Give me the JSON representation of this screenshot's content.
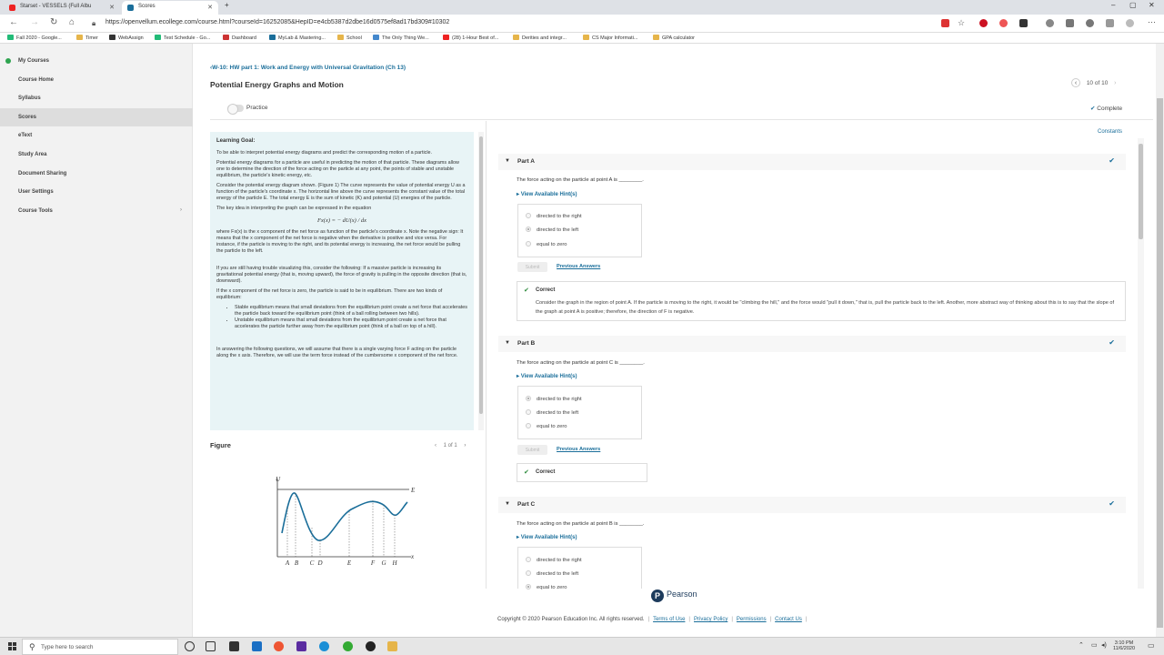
{
  "browser": {
    "tabs": [
      {
        "title": "Starset - VESSELS (Full Albu",
        "active": false
      },
      {
        "title": "Scores",
        "active": true
      }
    ],
    "new_tab": "+",
    "url": "https://openvellum.ecollege.com/course.html?courseId=16252085&HepID=e4cb5387d2dbe16d0575ef8ad17bd309#10302",
    "bookmarks": [
      "Fall 2020 - Google...",
      "Timer",
      "WebAssign",
      "Test Schedule - Go...",
      "Dashboard",
      "MyLab & Mastering...",
      "School",
      "The Only Thing We...",
      "(28) 1-Hour Best of...",
      "Derities and integr...",
      "CS Major Informati...",
      "GPA calculator"
    ]
  },
  "sidebar": {
    "items": [
      {
        "label": "My Courses"
      },
      {
        "label": "Course Home"
      },
      {
        "label": "Syllabus"
      },
      {
        "label": "Scores"
      },
      {
        "label": "eText"
      },
      {
        "label": "Study Area"
      },
      {
        "label": "Document Sharing"
      },
      {
        "label": "User Settings"
      },
      {
        "label": "Course Tools",
        "chevron": "›"
      }
    ]
  },
  "header": {
    "breadcrumb": "W-10: HW part 1: Work and Energy with Universal Gravitation (Ch 13)",
    "title": "Potential Energy Graphs and Motion",
    "pager": "10 of 10",
    "practice_label": "Practice",
    "status": "Complete"
  },
  "intro": {
    "heading": "Learning Goal:",
    "goal": "To be able to interpret potential energy diagrams and predict the corresponding motion of a particle.",
    "p1": "Potential energy diagrams for a particle are useful in predicting the motion of that particle. These diagrams allow one to determine the direction of the force acting on the particle at any point, the points of stable and unstable equilibrium, the particle's kinetic energy, etc.",
    "p2": "Consider the potential energy diagram shown. (Figure 1) The curve represents the value of potential energy U as a function of the particle's coordinate x. The horizontal line above the curve represents the constant value of the total energy of the particle E. The total energy E is the sum of kinetic (K) and potential (U) energies of the particle.",
    "p3": "The key idea in interpreting the graph can be expressed in the equation",
    "equation": "Fx(x) = − dU(x) / dx",
    "p4": "where Fx(x) is the x component of the net force as function of the particle's coordinate x. Note the negative sign: It means that the x component of the net force is negative when the derivative is positive and vice versa. For instance, if the particle is moving to the right, and its potential energy is increasing, the net force would be pulling the particle to the left.",
    "p5": "If you are still having trouble visualizing this, consider the following: If a massive particle is increasing its gravitational potential energy (that is, moving upward), the force of gravity is pulling in the opposite direction (that is, downward).",
    "p6": "If the x component of the net force is zero, the particle is said to be in equilibrium. There are two kinds of equilibrium:",
    "li1": "Stable equilibrium means that small deviations from the equilibrium point create a net force that accelerates the particle back toward the equilibrium point (think of a ball rolling between two hills).",
    "li2": "Unstable equilibrium means that small deviations from the equilibrium point create a net force that accelerates the particle further away from the equilibrium point (think of a ball on top of a hill).",
    "p7": "In answering the following questions, we will assume that there is a single varying force F acting on the particle along the x axis. Therefore, we will use the term force instead of the cumbersome x component of the net force."
  },
  "figure": {
    "label": "Figure",
    "pager": "1 of 1",
    "axis_y": "U",
    "axis_x": "x",
    "energy": "E",
    "points": [
      "A",
      "B",
      "C",
      "D",
      "E",
      "F",
      "G",
      "H"
    ]
  },
  "constants": "Constants",
  "parts": [
    {
      "label": "Part A",
      "question": "The force acting on the particle at point A is ________.",
      "hint": "View Available Hint(s)",
      "choices": [
        "directed to the right",
        "directed to the left",
        "equal to zero"
      ],
      "selected": 1,
      "submit": "Submit",
      "previous": "Previous Answers",
      "result": "Correct",
      "explanation": "Consider the graph in the region of point A. If the particle is moving to the right, it would be \"climbing the hill,\" and the force would \"pull it down,\" that is, pull the particle back to the left. Another, more abstract way of thinking about this is to say that the slope of the graph at point A is positive; therefore, the direction of F is negative."
    },
    {
      "label": "Part B",
      "question": "The force acting on the particle at point C is ________.",
      "hint": "View Available Hint(s)",
      "choices": [
        "directed to the right",
        "directed to the left",
        "equal to zero"
      ],
      "selected": 0,
      "submit": "Submit",
      "previous": "Previous Answers",
      "result": "Correct"
    },
    {
      "label": "Part C",
      "question": "The force acting on the particle at point B is ________.",
      "hint": "View Available Hint(s)",
      "choices": [
        "directed to the right",
        "directed to the left",
        "equal to zero"
      ],
      "selected": 2
    }
  ],
  "footer": {
    "brand": "Pearson",
    "copyright": "Copyright © 2020 Pearson Education Inc. All rights reserved.",
    "links": [
      "Terms of Use",
      "Privacy Policy",
      "Permissions",
      "Contact Us"
    ]
  },
  "taskbar": {
    "search_placeholder": "Type here to search",
    "time": "3:10 PM",
    "date": "11/6/2020"
  },
  "colors": {
    "link": "#1a6e9a",
    "correct": "#2e8b3d",
    "intro_bg": "#e8f4f6"
  }
}
